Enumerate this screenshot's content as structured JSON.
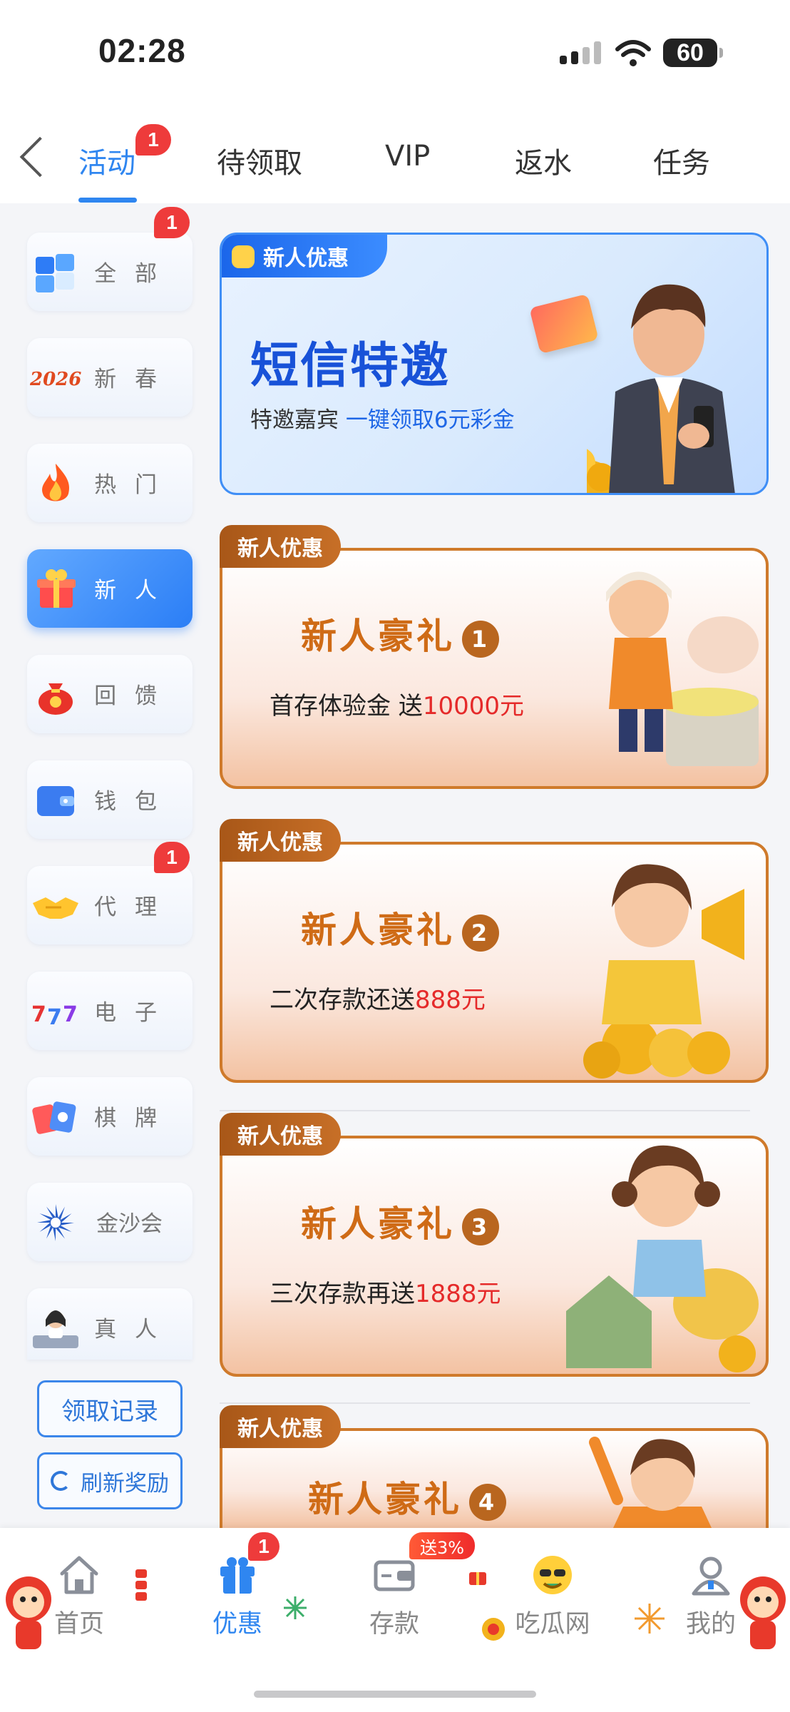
{
  "status_bar": {
    "time": "02:28",
    "battery": "60"
  },
  "tabs": [
    {
      "label": "活动",
      "badge": "1",
      "active": true
    },
    {
      "label": "待领取"
    },
    {
      "label": "VIP"
    },
    {
      "label": "返水"
    },
    {
      "label": "任务"
    }
  ],
  "sidebar": {
    "items": [
      {
        "label": "全 部",
        "icon": "cubes-icon",
        "badge": "1"
      },
      {
        "label": "新 春",
        "icon": "year-2026-icon"
      },
      {
        "label": "热 门",
        "icon": "flame-icon"
      },
      {
        "label": "新 人",
        "icon": "gift-icon",
        "active": true
      },
      {
        "label": "回 馈",
        "icon": "money-bag-icon"
      },
      {
        "label": "钱 包",
        "icon": "wallet-icon"
      },
      {
        "label": "代 理",
        "icon": "handshake-icon",
        "badge": "1"
      },
      {
        "label": "电 子",
        "icon": "slot-777-icon"
      },
      {
        "label": "棋 牌",
        "icon": "playing-cards-icon"
      },
      {
        "label": "金沙会",
        "icon": "sunburst-logo-icon"
      },
      {
        "label": "真 人",
        "icon": "live-dealer-icon"
      }
    ],
    "record_button": "领取记录",
    "refresh_button": "刷新奖励"
  },
  "hero_banner": {
    "tag": "新人优惠",
    "title": "短信特邀",
    "subtitle_prefix": "特邀嘉宾 ",
    "subtitle_highlight": "一键领取6元彩金"
  },
  "promos": [
    {
      "tag": "新人优惠",
      "title": "新人豪礼",
      "number": "1",
      "subtitle_prefix": "首存体验金 送",
      "subtitle_highlight": "10000元"
    },
    {
      "tag": "新人优惠",
      "title": "新人豪礼",
      "number": "2",
      "subtitle_prefix": "二次存款还送",
      "subtitle_highlight": "888元"
    },
    {
      "tag": "新人优惠",
      "title": "新人豪礼",
      "number": "3",
      "subtitle_prefix": "三次存款再送",
      "subtitle_highlight": "1888元"
    },
    {
      "tag": "新人优惠",
      "title": "新人豪礼",
      "number": "4",
      "subtitle_prefix": "",
      "subtitle_highlight": ""
    }
  ],
  "bottom_nav": {
    "items": [
      {
        "label": "首页",
        "icon": "home-icon"
      },
      {
        "label": "优惠",
        "icon": "gift-icon",
        "badge": "1",
        "active": true
      },
      {
        "label": "存款",
        "icon": "wallet-icon",
        "badge": "送3%"
      },
      {
        "label": "吃瓜网",
        "icon": "emoji-icon"
      },
      {
        "label": "我的",
        "icon": "user-icon"
      }
    ]
  },
  "colors": {
    "accent": "#2f86f0",
    "badge_red": "#ee3b3b",
    "promo_orange": "#cf7a2b"
  }
}
